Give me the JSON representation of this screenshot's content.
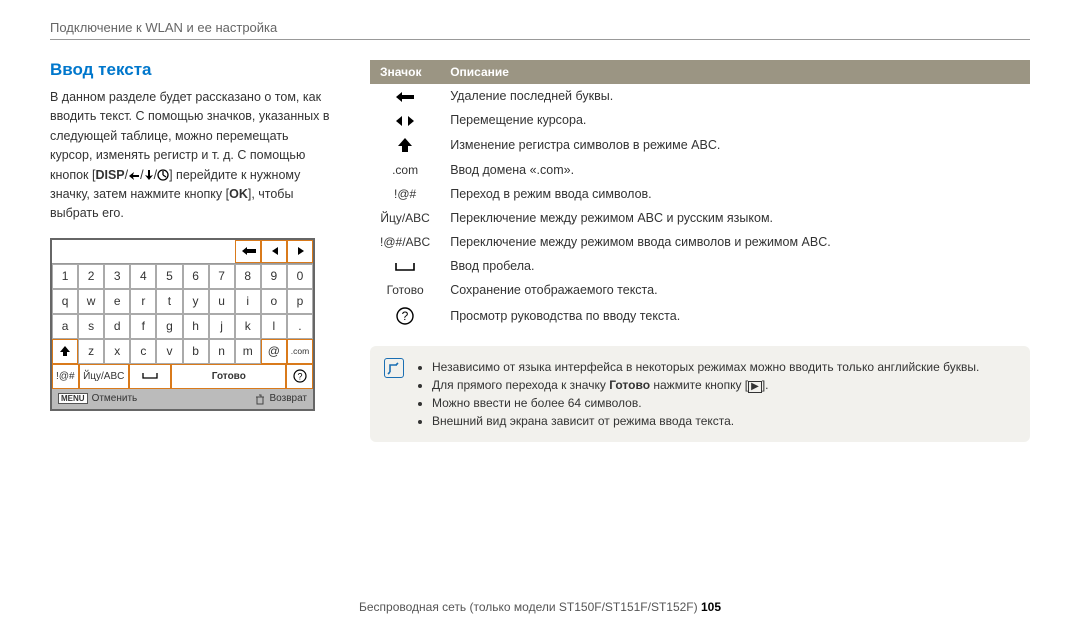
{
  "header": "Подключение к WLAN и ее настройка",
  "title": "Ввод текста",
  "intro_parts": {
    "p1": "В данном разделе будет рассказано о том, как вводить текст. С помощью значков, указанных в следующей таблице, можно перемещать курсор, изменять регистр и т. д. С помощью кнопок [",
    "disp": "DISP",
    "p2": "] перейдите к нужному значку, затем нажмите кнопку [",
    "ok": "OK",
    "p3": "], чтобы выбрать его."
  },
  "keyboard": {
    "rows": [
      [
        "1",
        "2",
        "3",
        "4",
        "5",
        "6",
        "7",
        "8",
        "9",
        "0"
      ],
      [
        "q",
        "w",
        "e",
        "r",
        "t",
        "y",
        "u",
        "i",
        "o",
        "p"
      ],
      [
        "a",
        "s",
        "d",
        "f",
        "g",
        "h",
        "j",
        "k",
        "l",
        "."
      ],
      [
        "↑",
        "z",
        "x",
        "c",
        "v",
        "b",
        "n",
        "m",
        "@",
        ".com"
      ]
    ],
    "bottom": {
      "sym": "!@#",
      "lang": "Йцу/ABC",
      "space": "⌴",
      "done": "Готово",
      "help": "?"
    },
    "footer": {
      "cancel_label": "Отменить",
      "back_label": "Возврат",
      "menu": "MENU"
    }
  },
  "table": {
    "h_icon": "Значок",
    "h_desc": "Описание",
    "rows": [
      {
        "icon": "backspace",
        "desc": "Удаление последней буквы."
      },
      {
        "icon": "move",
        "desc": "Перемещение курсора."
      },
      {
        "icon": "shift",
        "desc": "Изменение регистра символов в режиме ABC."
      },
      {
        "icon": "dotcom",
        "text": ".com",
        "desc": "Ввод домена «.com»."
      },
      {
        "icon": "sym",
        "text": "!@#",
        "desc": "Переход в режим ввода символов."
      },
      {
        "icon": "lang",
        "text": "Йцу/ABC",
        "desc": "Переключение между режимом ABC и русским языком."
      },
      {
        "icon": "symabc",
        "text": "!@#/ABC",
        "desc": "Переключение между режимом ввода символов и режимом ABC."
      },
      {
        "icon": "space",
        "desc": "Ввод пробела."
      },
      {
        "icon": "done",
        "text": "Готово",
        "desc": "Сохранение отображаемого текста."
      },
      {
        "icon": "help",
        "desc": "Просмотр руководства по вводу текста."
      }
    ]
  },
  "notes": {
    "n1": "Независимо от языка интерфейса в некоторых режимах можно вводить только английские буквы.",
    "n2a": "Для прямого перехода к значку ",
    "n2b": "Готово",
    "n2c": " нажмите кнопку [",
    "n2d": "].",
    "n3": "Можно ввести не более 64 символов.",
    "n4": "Внешний вид экрана зависит от режима ввода текста."
  },
  "footer": {
    "text": "Беспроводная сеть (только модели ST150F/ST151F/ST152F)  ",
    "page": "105"
  }
}
